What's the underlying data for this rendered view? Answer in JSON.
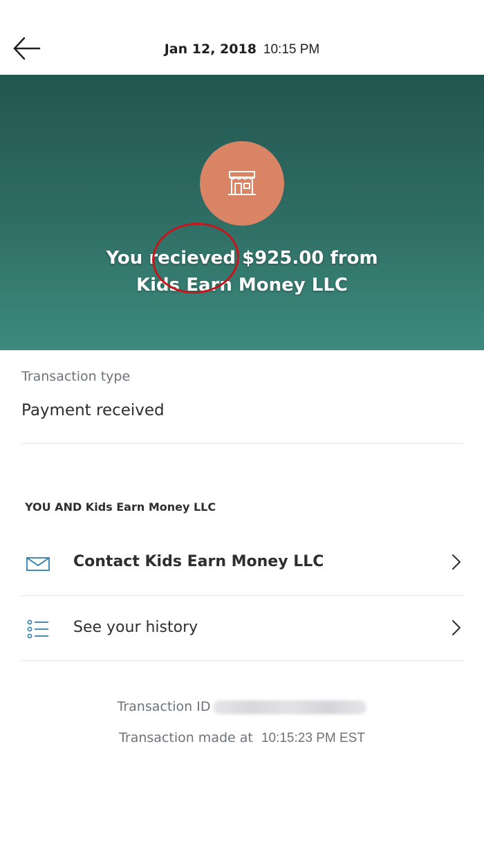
{
  "header": {
    "date": "Jan 12, 2018",
    "time": "10:15 PM",
    "back_icon": "arrow-left-icon"
  },
  "hero": {
    "line1": "You recieved $925.00 from",
    "line2": "Kids Earn Money LLC",
    "merchant_icon": "storefront-icon",
    "background_colors": [
      "#225650",
      "#3d8a7e"
    ],
    "avatar_color": "#d98464",
    "annotation_color": "#c4161c"
  },
  "transaction": {
    "type_label": "Transaction type",
    "type_value": "Payment received"
  },
  "section": {
    "heading": "YOU AND Kids Earn Money LLC"
  },
  "actions": [
    {
      "label": "Contact Kids Earn Money LLC",
      "icon": "envelope-icon"
    },
    {
      "label": "See your history",
      "icon": "list-icon"
    }
  ],
  "footer": {
    "transaction_id_label": "Transaction ID",
    "made_at_label": "Transaction made at",
    "made_at_value": "10:15:23 PM EST"
  }
}
